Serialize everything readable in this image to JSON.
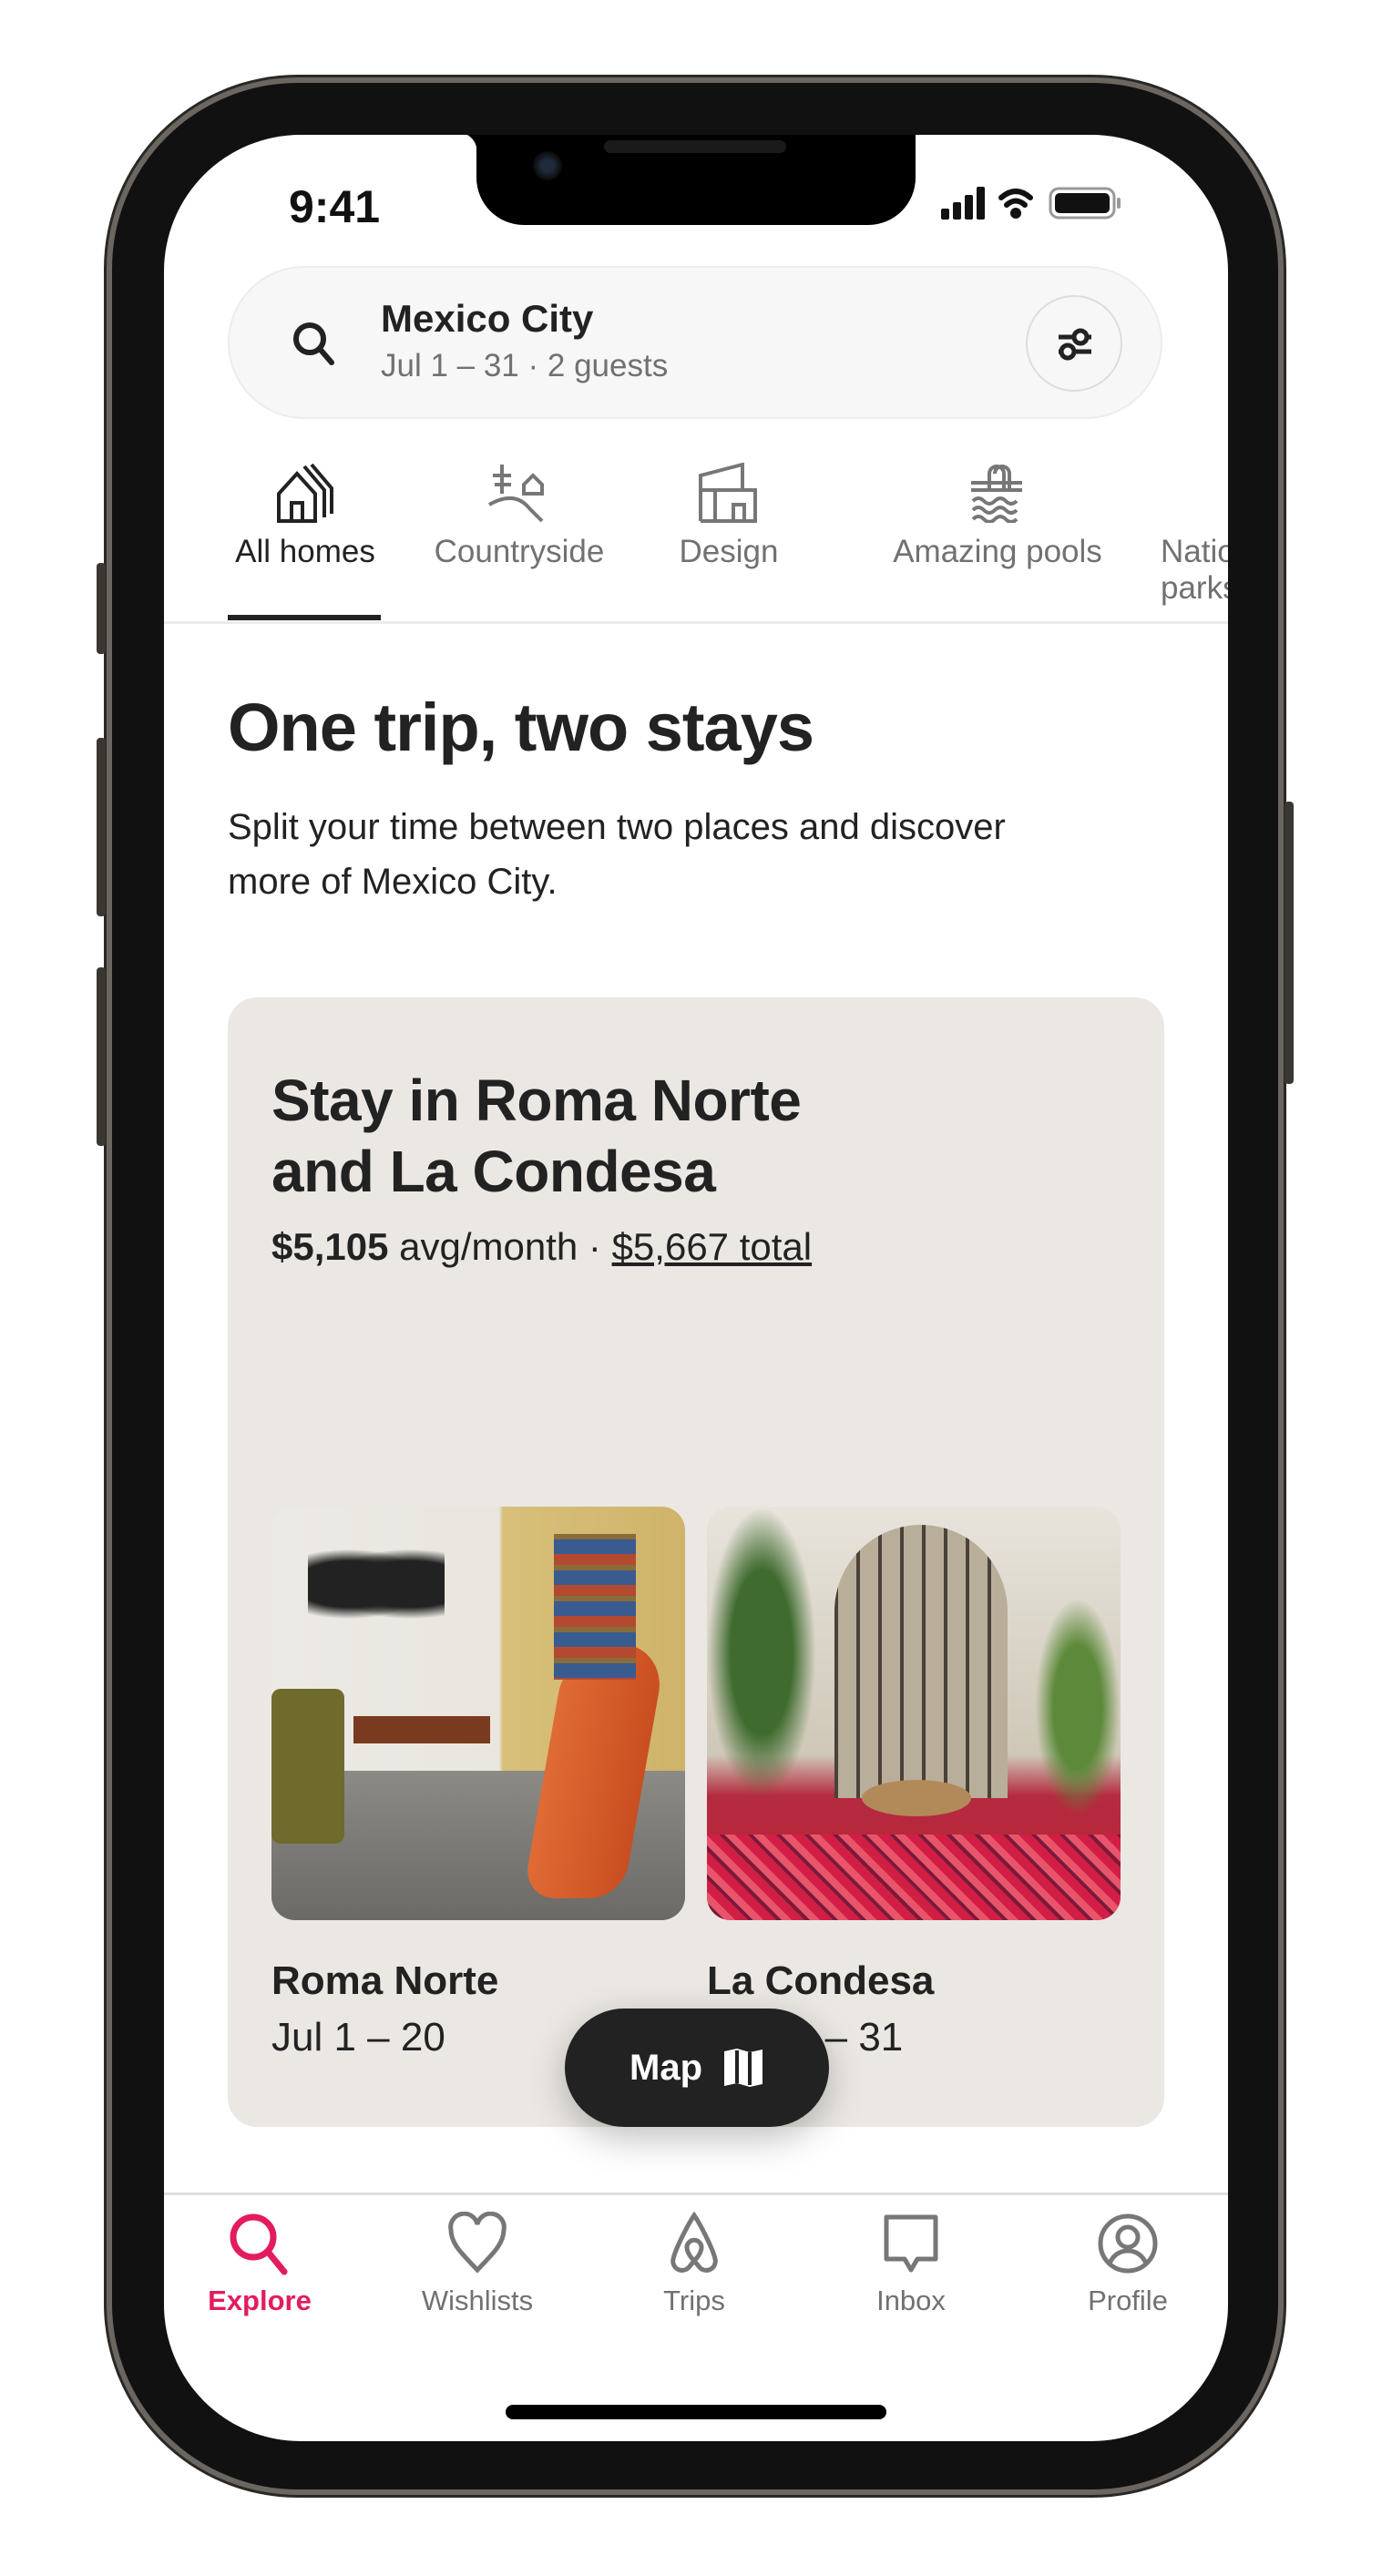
{
  "status": {
    "time": "9:41"
  },
  "search": {
    "location": "Mexico City",
    "details": "Jul 1 – 31 · 2 guests",
    "icon": "search-icon",
    "filter_icon": "filter-sliders-icon"
  },
  "categories": [
    {
      "label": "All homes",
      "icon": "homes-icon",
      "active": true
    },
    {
      "label": "Countryside",
      "icon": "countryside-icon"
    },
    {
      "label": "Design",
      "icon": "design-building-icon"
    },
    {
      "label": "Amazing pools",
      "icon": "pool-icon"
    },
    {
      "label": "National parks",
      "icon": "park-icon"
    }
  ],
  "section": {
    "title": "One trip, two stays",
    "subtitle": "Split your time between two places and discover more of Mexico City."
  },
  "card": {
    "title_line1": "Stay in Roma Norte",
    "title_line2": "and La Condesa",
    "price": "$5,105",
    "price_unit": " avg/month · ",
    "total": "$5,667 total",
    "stays": [
      {
        "name": "Roma Norte",
        "dates": "Jul 1 – 20"
      },
      {
        "name": "La Condesa",
        "dates": "Jul 21 – 31"
      }
    ]
  },
  "map_button": {
    "label": "Map",
    "icon": "map-icon"
  },
  "tabs": [
    {
      "label": "Explore",
      "icon": "search-icon",
      "active": true
    },
    {
      "label": "Wishlists",
      "icon": "heart-icon"
    },
    {
      "label": "Trips",
      "icon": "airbnb-logo-icon"
    },
    {
      "label": "Inbox",
      "icon": "message-icon"
    },
    {
      "label": "Profile",
      "icon": "profile-icon"
    }
  ],
  "colors": {
    "accent": "#E31C5F",
    "card_bg": "#EBE8E3",
    "text": "#222222",
    "muted": "#717171"
  }
}
